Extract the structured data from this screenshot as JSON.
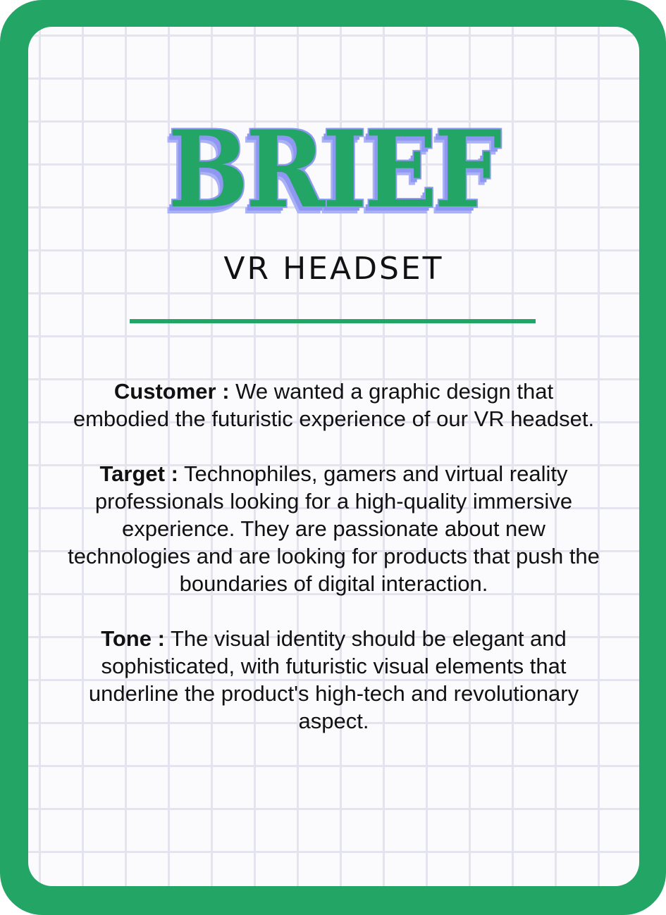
{
  "title": "BRIEF",
  "subtitle": "VR HEADSET",
  "sections": [
    {
      "label": "Customer :",
      "text": "We wanted a graphic design that embodied the futuristic experience of our VR headset."
    },
    {
      "label": "Target :",
      "text": "Technophiles, gamers and virtual reality professionals looking for a high-quality immersive experience. They are passionate about new technologies and are looking for products that push the boundaries of digital interaction."
    },
    {
      "label": "Tone :",
      "text": "The visual identity should be elegant and sophisticated, with futuristic visual elements that underline the product's high-tech and revolutionary aspect."
    }
  ],
  "colors": {
    "accent_green": "#22a565",
    "title_shadow_periwinkle": "#8e98f2",
    "grid_line": "#e4e4ef"
  }
}
